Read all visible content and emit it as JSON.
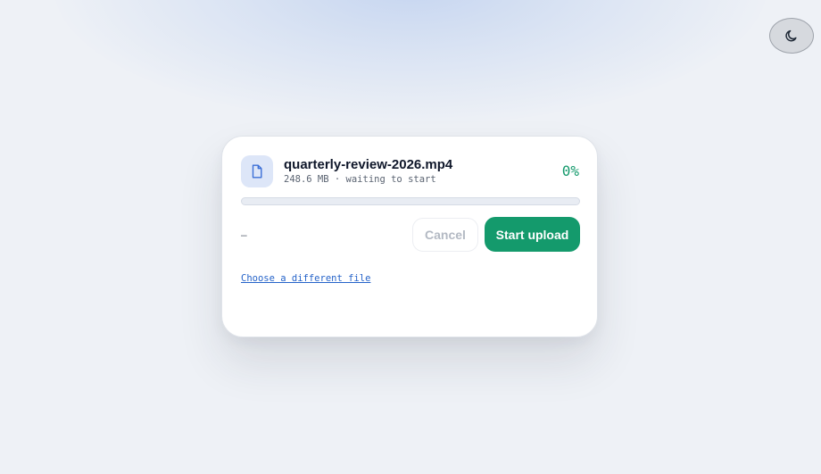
{
  "theme_toggle": {
    "icon": "moon-icon"
  },
  "upload": {
    "file_icon": "file-icon",
    "file_name": "quarterly-review-2026.mp4",
    "file_meta": "248.6 MB · waiting to start",
    "percent_label": "0%",
    "progress": 0,
    "status": "–",
    "cancel_label": "Cancel",
    "start_label": "Start upload",
    "choose_link": "Choose a different file"
  },
  "colors": {
    "accent": "#149a6c",
    "link": "#2563c9",
    "background": "#eef1f6",
    "icon_tile": "#dde6f8"
  }
}
